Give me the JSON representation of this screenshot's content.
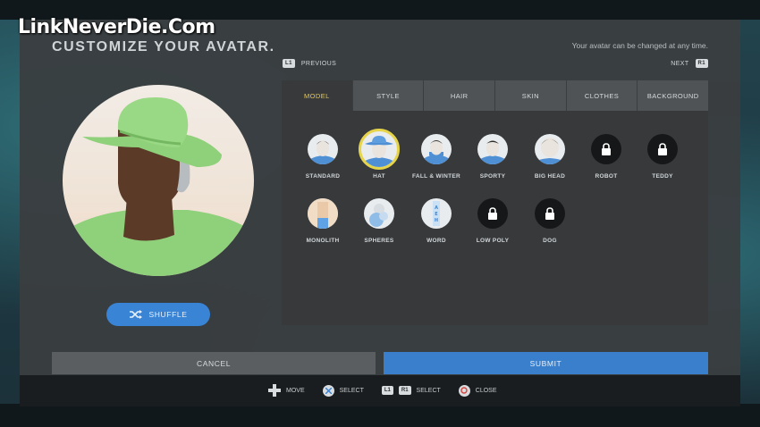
{
  "watermark": "LinkNeverDie.Com",
  "header": {
    "title": "CUSTOMIZE YOUR AVATAR.",
    "note": "Your avatar can be changed at any time."
  },
  "nav": {
    "prev_badge": "L1",
    "prev_label": "PREVIOUS",
    "next_label": "NEXT",
    "next_badge": "R1"
  },
  "tabs": [
    {
      "label": "MODEL",
      "active": true
    },
    {
      "label": "STYLE",
      "active": false
    },
    {
      "label": "HAIR",
      "active": false
    },
    {
      "label": "SKIN",
      "active": false
    },
    {
      "label": "CLOTHES",
      "active": false
    },
    {
      "label": "BACKGROUND",
      "active": false
    }
  ],
  "models": [
    {
      "label": "STANDARD",
      "icon": "standard-head-icon"
    },
    {
      "label": "HAT",
      "icon": "hat-head-icon",
      "selected": true
    },
    {
      "label": "FALL & WINTER",
      "icon": "winter-head-icon"
    },
    {
      "label": "SPORTY",
      "icon": "sporty-head-icon"
    },
    {
      "label": "BIG HEAD",
      "icon": "big-head-icon"
    },
    {
      "label": "ROBOT",
      "icon": "lock-icon",
      "locked": true
    },
    {
      "label": "TEDDY",
      "icon": "lock-icon",
      "locked": true
    },
    {
      "label": "MONOLITH",
      "icon": "monolith-icon"
    },
    {
      "label": "SPHERES",
      "icon": "spheres-icon"
    },
    {
      "label": "WORD",
      "icon": "word-icon"
    },
    {
      "label": "LOW POLY",
      "icon": "lock-icon",
      "locked": true
    },
    {
      "label": "DOG",
      "icon": "lock-icon",
      "locked": true
    }
  ],
  "shuffle_label": "SHUFFLE",
  "actions": {
    "cancel": "CANCEL",
    "submit": "SUBMIT"
  },
  "hints": {
    "move": "MOVE",
    "select_cross": "SELECT",
    "l1": "L1",
    "r1": "R1",
    "select_bumpers": "SELECT",
    "close": "CLOSE"
  },
  "colors": {
    "accent_blue": "#3a7fcb",
    "active_tab_text": "#e8c94f",
    "selection_ring": "#e6d54a",
    "avatar_green": "#8fd07a"
  }
}
